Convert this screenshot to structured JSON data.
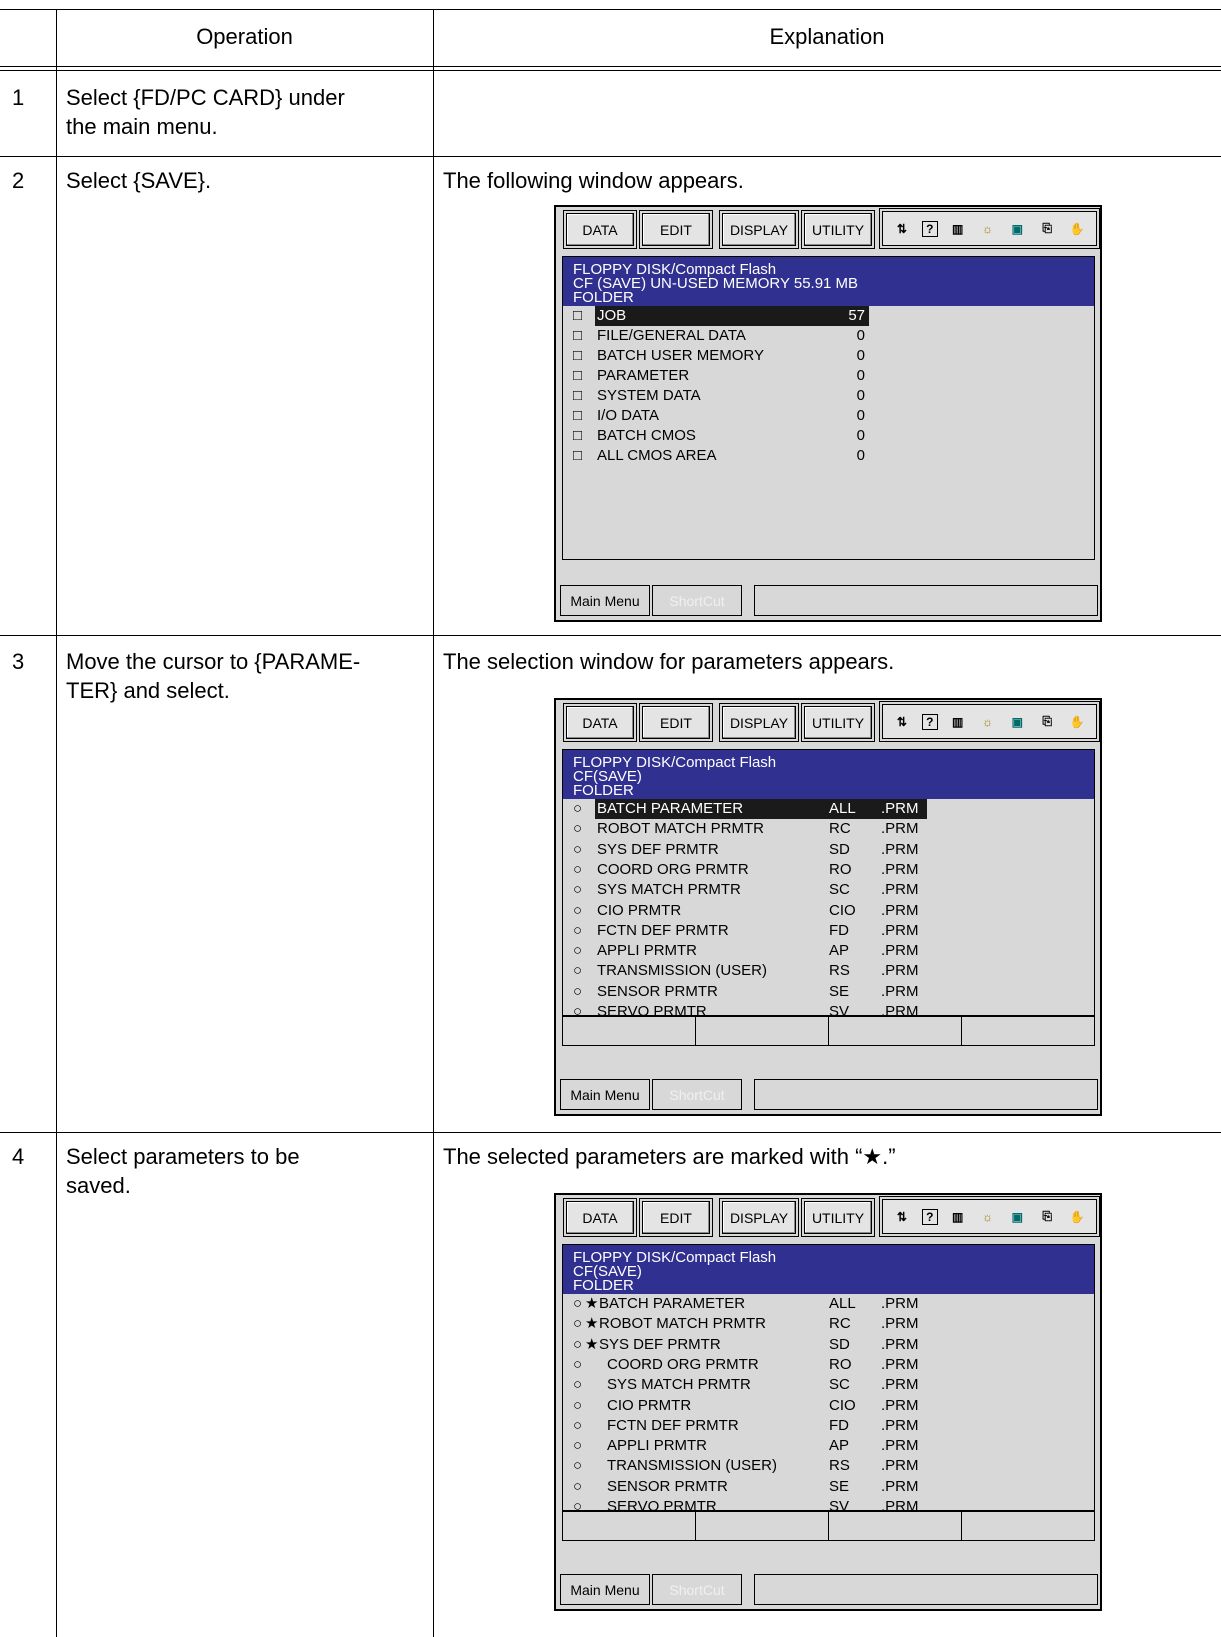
{
  "header": {
    "operation": "Operation",
    "explanation": "Explanation"
  },
  "steps": [
    {
      "num": "1",
      "operation": [
        "Select {FD/PC CARD} under",
        "the main menu."
      ],
      "explanation": ""
    },
    {
      "num": "2",
      "operation": [
        "Select {SAVE}."
      ],
      "explanation": "The following window appears."
    },
    {
      "num": "3",
      "operation": [
        "Move the cursor to {PARAME-",
        "TER} and select."
      ],
      "explanation": "The selection window for parameters appears."
    },
    {
      "num": "4",
      "operation": [
        "Select parameters to be",
        "saved."
      ],
      "explanation": "The selected parameters are marked with “★.”"
    }
  ],
  "pendant": {
    "menu": {
      "data": "DATA",
      "edit": "EDIT",
      "display": "DISPLAY",
      "utility": "UTILITY"
    },
    "main_menu": "Main Menu",
    "shortcut": "ShortCut"
  },
  "screen1": {
    "title": [
      "FLOPPY DISK/Compact Flash",
      "CF (SAVE) UN-USED MEMORY 55.91 MB",
      "FOLDER"
    ],
    "mark": "□",
    "rows": [
      {
        "label": "JOB",
        "count": "57"
      },
      {
        "label": "FILE/GENERAL DATA",
        "count": "0"
      },
      {
        "label": "BATCH USER MEMORY",
        "count": "0"
      },
      {
        "label": "PARAMETER",
        "count": "0"
      },
      {
        "label": "SYSTEM DATA",
        "count": "0"
      },
      {
        "label": "I/O DATA",
        "count": "0"
      },
      {
        "label": "BATCH CMOS",
        "count": "0"
      },
      {
        "label": "ALL CMOS AREA",
        "count": "0"
      }
    ]
  },
  "screen2": {
    "title": [
      "FLOPPY DISK/Compact Flash",
      "CF(SAVE)",
      "FOLDER"
    ],
    "mark": "○",
    "star": "★",
    "rows": [
      {
        "label": "BATCH PARAMETER",
        "code": "ALL",
        "ext": ".PRM"
      },
      {
        "label": "ROBOT MATCH PRMTR",
        "code": "RC",
        "ext": ".PRM"
      },
      {
        "label": "SYS DEF PRMTR",
        "code": "SD",
        "ext": ".PRM"
      },
      {
        "label": "COORD ORG PRMTR",
        "code": "RO",
        "ext": ".PRM"
      },
      {
        "label": "SYS MATCH PRMTR",
        "code": "SC",
        "ext": ".PRM"
      },
      {
        "label": "CIO PRMTR",
        "code": "CIO",
        "ext": ".PRM"
      },
      {
        "label": "FCTN DEF PRMTR",
        "code": "FD",
        "ext": ".PRM"
      },
      {
        "label": "APPLI PRMTR",
        "code": "AP",
        "ext": ".PRM"
      },
      {
        "label": "TRANSMISSION (USER)",
        "code": "RS",
        "ext": ".PRM"
      },
      {
        "label": "SENSOR PRMTR",
        "code": "SE",
        "ext": ".PRM"
      },
      {
        "label": "SERVO PRMTR",
        "code": "SV",
        "ext": ".PRM"
      }
    ]
  },
  "screen3": {
    "starred": [
      true,
      true,
      true,
      false,
      false,
      false,
      false,
      false,
      false,
      false,
      false
    ]
  }
}
